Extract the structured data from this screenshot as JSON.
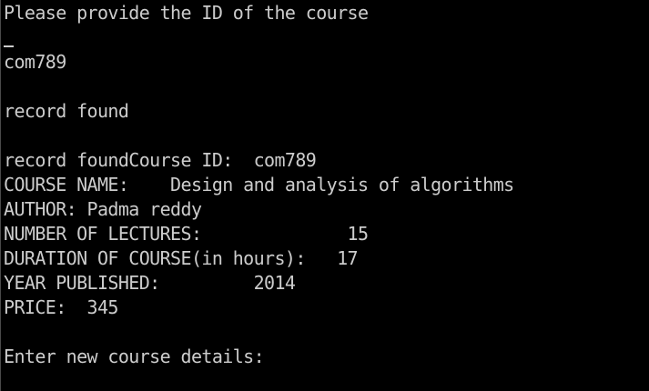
{
  "console": {
    "lines": {
      "prompt_id": "Please provide the ID of the course",
      "input_id": "com789",
      "blank_1": "",
      "record_found": "record found",
      "blank_2": "",
      "record_found_course_id": "record foundCourse ID:  com789",
      "course_name": "COURSE NAME:    Design and analysis of algorithms",
      "author": "AUTHOR: Padma reddy",
      "number_of_lectures": "NUMBER OF LECTURES:              15",
      "duration": "DURATION OF COURSE(in hours):   17",
      "year_published": "YEAR PUBLISHED:         2014",
      "price": "PRICE:  345",
      "blank_3": "",
      "enter_new_details": "Enter new course details:"
    }
  }
}
